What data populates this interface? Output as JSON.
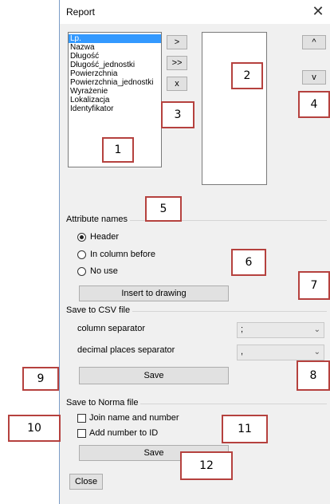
{
  "window": {
    "title": "Report",
    "close_glyph": "✕"
  },
  "available_list": [
    "Lp.",
    "Nazwa",
    "Długość",
    "Długość_jednostki",
    "Powierzchnia",
    "Powierzchnia_jednostki",
    "Wyrażenie",
    "Lokalizacja",
    "Identyfikator"
  ],
  "move_buttons": {
    "add": ">",
    "add_all": ">>",
    "remove": "x"
  },
  "order_buttons": {
    "up": "^",
    "down": "v"
  },
  "attribute_names": {
    "label": "Attribute names",
    "options": [
      "Header",
      "In column before",
      "No use"
    ],
    "selected": "Header"
  },
  "insert_button": "Insert to drawing",
  "csv": {
    "label": "Save to CSV file",
    "column_separator_label": "column separator",
    "column_separator_value": ";",
    "decimal_separator_label": "decimal places separator",
    "decimal_separator_value": ",",
    "save_label": "Save"
  },
  "norma": {
    "label": "Save to Norma file",
    "join_label": "Join name and number",
    "add_number_label": "Add number to ID",
    "save_label": "Save"
  },
  "close_button": "Close",
  "callouts": [
    "1",
    "2",
    "3",
    "4",
    "5",
    "6",
    "7",
    "8",
    "9",
    "10",
    "11",
    "12"
  ],
  "colors": {
    "selection": "#3399ff",
    "callout_border": "#b5413e",
    "dialog_bg": "#f0f0f0"
  }
}
